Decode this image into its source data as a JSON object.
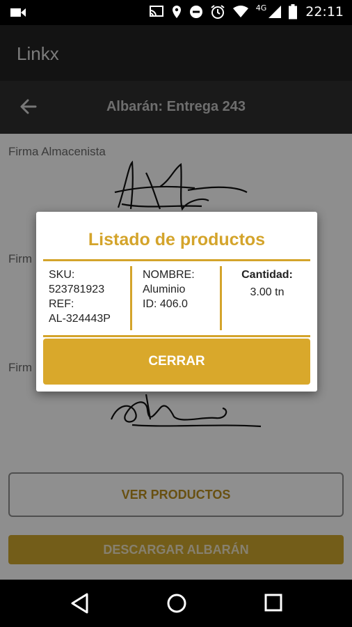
{
  "status_bar": {
    "network": "4G",
    "time": "22:11",
    "icons": [
      "video-camera-icon",
      "cast-icon",
      "location-icon",
      "do-not-disturb-icon",
      "alarm-icon",
      "wifi-icon",
      "signal-icon",
      "battery-icon"
    ]
  },
  "app_bar": {
    "title": "Linkx"
  },
  "sub_bar": {
    "title": "Albarán: Entrega 243",
    "back_icon": "arrow-back-icon"
  },
  "signatures": {
    "labels": [
      "Firma Almacenista",
      "Firm",
      "Firm"
    ]
  },
  "actions": {
    "ver_productos": "VER PRODUCTOS",
    "descargar": "DESCARGAR ALBARÁN"
  },
  "dialog": {
    "title": "Listado de productos",
    "col1": {
      "sku_label": "SKU:",
      "sku": "523781923",
      "ref_label": "REF:",
      "ref": "AL-324443P"
    },
    "col2": {
      "nombre_label": "NOMBRE:",
      "nombre": "Aluminio",
      "id": "ID: 406.0"
    },
    "col3": {
      "cantidad_label": "Cantidad:",
      "cantidad": "3.00 tn"
    },
    "close_label": "CERRAR"
  },
  "nav_bar": {
    "icons": [
      "back-triangle-icon",
      "home-circle-icon",
      "recents-square-icon"
    ]
  },
  "colors": {
    "accent": "#d4a42b",
    "button": "#d9a82b",
    "appbar": "#222222"
  }
}
